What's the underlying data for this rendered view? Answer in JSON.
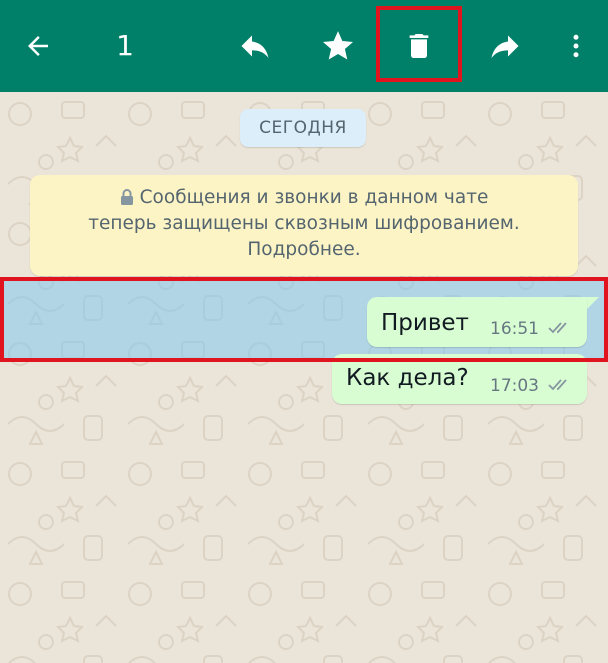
{
  "app_bar": {
    "selected_count": "1",
    "actions": [
      {
        "name": "back",
        "icon": "arrow-left-icon"
      },
      {
        "name": "reply",
        "icon": "reply-icon"
      },
      {
        "name": "star",
        "icon": "star-icon"
      },
      {
        "name": "delete",
        "icon": "trash-icon"
      },
      {
        "name": "forward",
        "icon": "forward-icon"
      },
      {
        "name": "more",
        "icon": "more-vert-icon"
      }
    ]
  },
  "chat": {
    "date_chip": "СЕГОДНЯ",
    "system_note": {
      "icon": "lock-icon",
      "line1": "Сообщения и звонки в данном чате",
      "line2": "теперь защищены сквозным шифрованием.",
      "line3": "Подробнее."
    },
    "messages": [
      {
        "text": "Привет",
        "time": "16:51",
        "status_icon": "double-check-icon",
        "selected": true
      },
      {
        "text": "Как дела?",
        "time": "17:03",
        "status_icon": "double-check-icon",
        "selected": false
      }
    ]
  },
  "colors": {
    "header": "#008069",
    "chat_background": "#ebe4d8",
    "outgoing_bubble": "#d9fdd3",
    "system_note": "#fdf4c5",
    "date_chip": "#dceef9",
    "selection": "#82c8f0",
    "highlight_outline": "#e0141e"
  }
}
